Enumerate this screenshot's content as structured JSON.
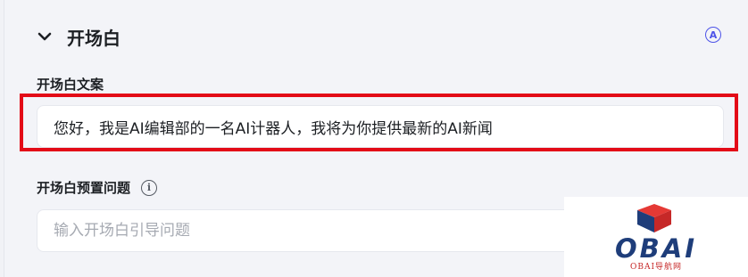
{
  "section": {
    "title": "开场白",
    "auto_icon_label": "A"
  },
  "opening_text": {
    "label": "开场白文案",
    "value": "您好，我是AI编辑部的一名AI计器人，我将为你提供最新的AI新闻"
  },
  "preset_questions": {
    "label": "开场白预置问题",
    "info_icon_label": "i",
    "placeholder": "输入开场白引导问题"
  },
  "watermark": {
    "logo_text": "OBAI",
    "subtitle": "OBAI导航网"
  },
  "colors": {
    "highlight": "#e30b17",
    "accent": "#4d53e8",
    "logo_blue": "#1e3d7a",
    "logo_red": "#c62828"
  },
  "icons": [
    "chevron-down-icon",
    "auto-icon",
    "info-icon"
  ]
}
